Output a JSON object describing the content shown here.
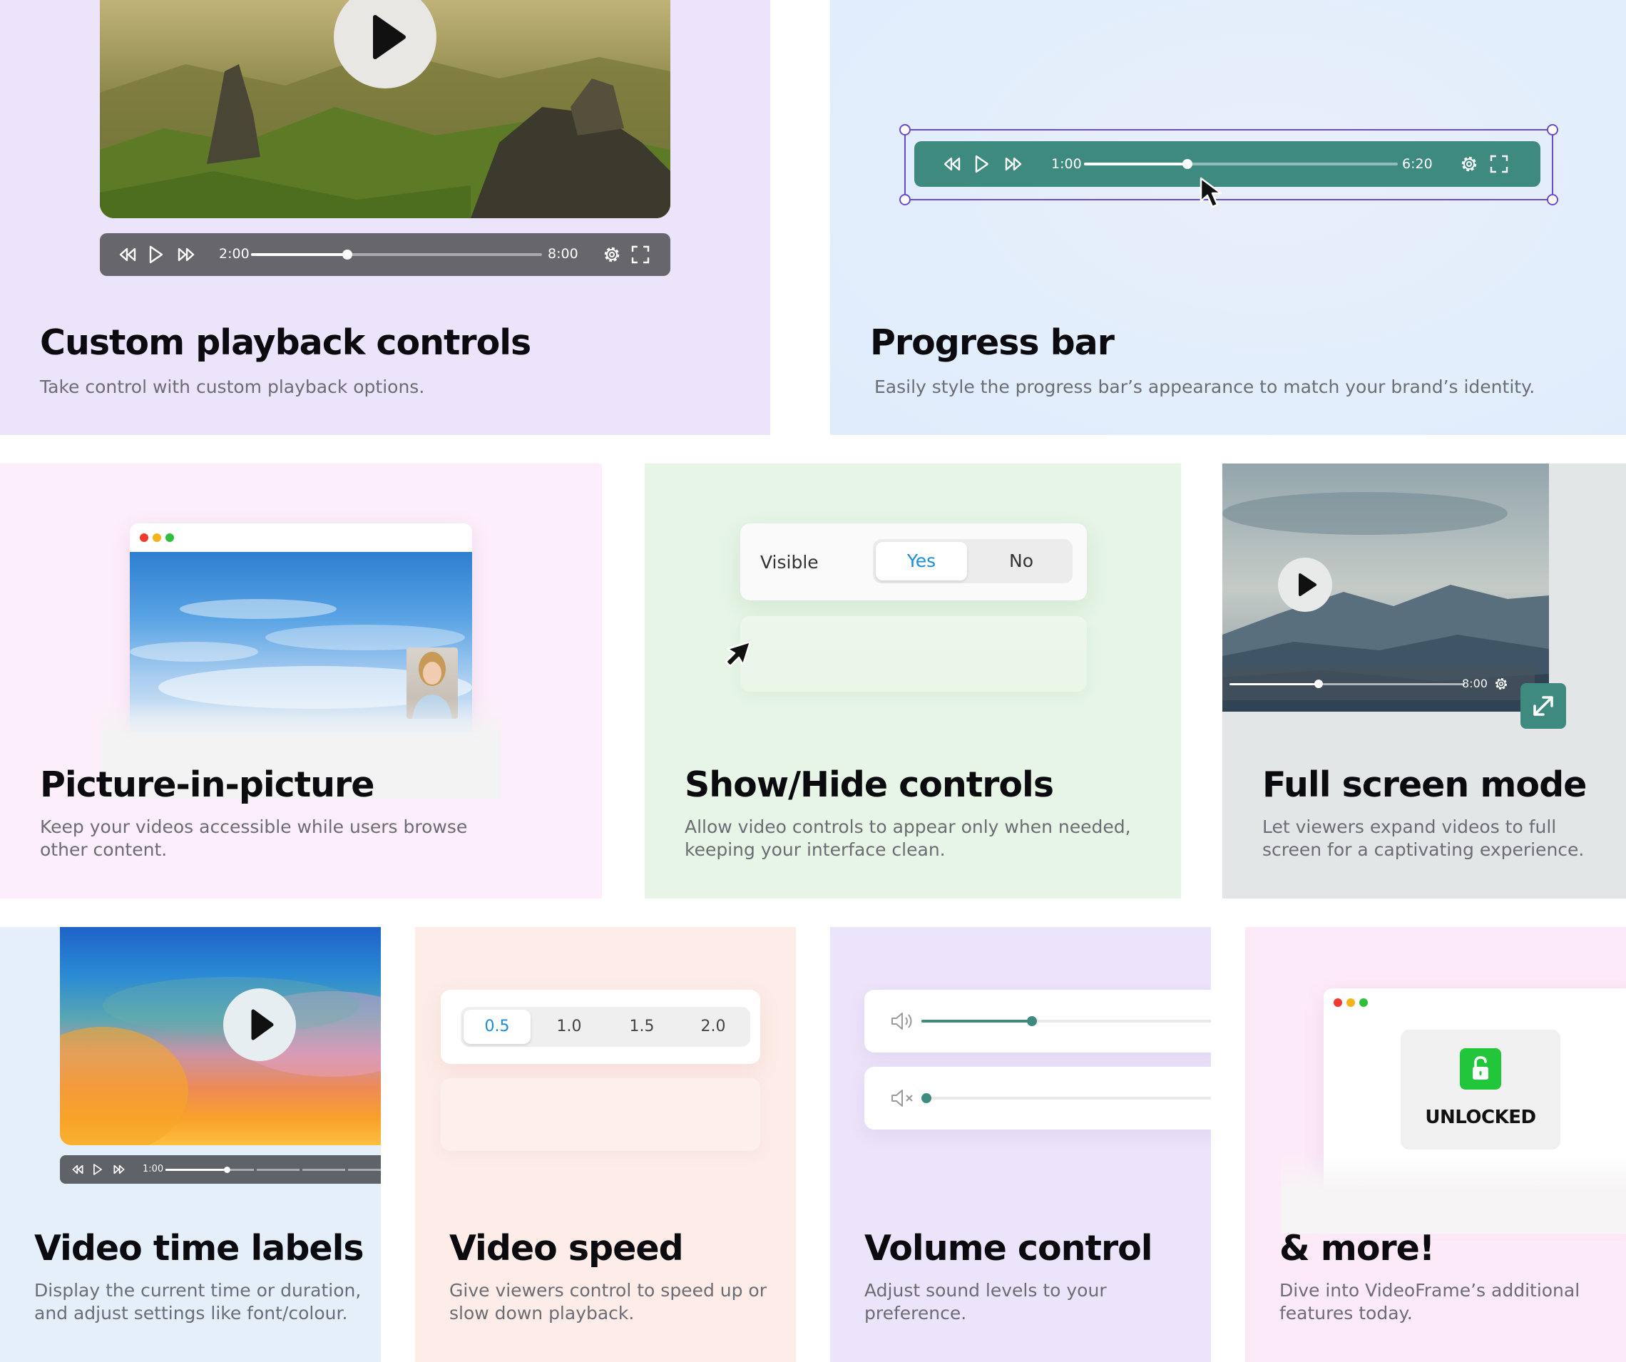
{
  "colors": {
    "teal": "#3e8a7e",
    "lavender_bg": "#ece4fa",
    "blue_bg": "#e2eefc",
    "pink_bg": "#fdeefb",
    "green_bg": "#e6f5e6",
    "gray_bg": "#e3e6e6",
    "peach_bg": "#fdece8",
    "accent_blue": "#1a8ed8",
    "unlock_green": "#22c63a"
  },
  "cards": {
    "custom_playback": {
      "title": "Custom playback controls",
      "desc": "Take control with custom playback options.",
      "current_time": "2:00",
      "duration": "8:00",
      "progress": 0.33
    },
    "progress_bar": {
      "title": "Progress bar",
      "desc": "Easily style the progress bar’s appearance to match your brand’s identity.",
      "current_time": "1:00",
      "duration": "6:20",
      "progress": 0.33
    },
    "pip": {
      "title": "Picture-in-picture",
      "desc": "Keep your videos accessible while users browse other content."
    },
    "show_hide": {
      "title": "Show/Hide controls",
      "desc": "Allow video controls to appear only when needed, keeping your interface clean.",
      "label": "Visible",
      "options": [
        "Yes",
        "No"
      ],
      "selected": "Yes"
    },
    "fullscreen": {
      "title": "Full screen mode",
      "desc": "Let viewers expand videos to full screen for a captivating experience.",
      "duration": "8:00",
      "progress": 0.38
    },
    "time_labels": {
      "title": "Video time labels",
      "desc": "Display the current time or duration, and adjust settings like font/colour.",
      "current_time": "1:00"
    },
    "speed": {
      "title": "Video speed",
      "desc": "Give viewers control to speed up or slow down playback.",
      "options": [
        "0.5",
        "1.0",
        "1.5",
        "2.0"
      ],
      "selected": "0.5"
    },
    "volume": {
      "title": "Volume control",
      "desc": "Adjust sound levels to your preference.",
      "level_on": 0.37,
      "level_muted": 0.0
    },
    "more": {
      "title": "& more!",
      "desc": "Dive into VideoFrame’s additional features today.",
      "badge": "UNLOCKED"
    }
  }
}
